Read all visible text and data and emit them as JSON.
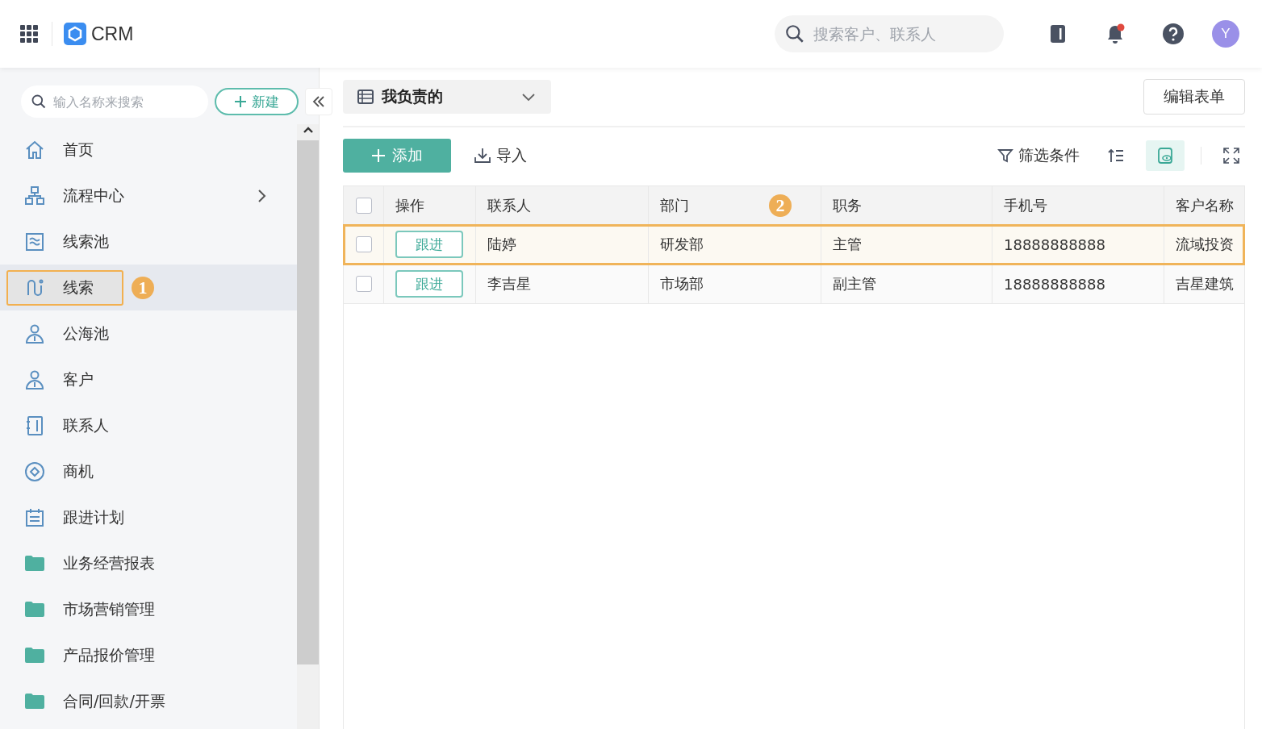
{
  "topbar": {
    "app_name": "CRM",
    "search": {
      "placeholder": "搜索客户、联系人"
    },
    "notification_dot": true,
    "avatar": "Y"
  },
  "sidebar": {
    "search": {
      "placeholder": "输入名称来搜索"
    },
    "new_button": "新建",
    "items": [
      {
        "label": "首页",
        "kind": "page",
        "selected": false,
        "expandable": false
      },
      {
        "label": "流程中心",
        "kind": "page",
        "selected": false,
        "expandable": true
      },
      {
        "label": "线索池",
        "kind": "page",
        "selected": false,
        "expandable": false
      },
      {
        "label": "线索",
        "kind": "page",
        "selected": true,
        "expandable": false,
        "callout": "1"
      },
      {
        "label": "公海池",
        "kind": "page",
        "selected": false,
        "expandable": false
      },
      {
        "label": "客户",
        "kind": "page",
        "selected": false,
        "expandable": false
      },
      {
        "label": "联系人",
        "kind": "page",
        "selected": false,
        "expandable": false
      },
      {
        "label": "商机",
        "kind": "page",
        "selected": false,
        "expandable": false
      },
      {
        "label": "跟进计划",
        "kind": "page",
        "selected": false,
        "expandable": false
      },
      {
        "label": "业务经营报表",
        "kind": "folder",
        "selected": false,
        "expandable": false
      },
      {
        "label": "市场营销管理",
        "kind": "folder",
        "selected": false,
        "expandable": false
      },
      {
        "label": "产品报价管理",
        "kind": "folder",
        "selected": false,
        "expandable": false
      },
      {
        "label": "合同/回款/开票",
        "kind": "folder",
        "selected": false,
        "expandable": false
      }
    ]
  },
  "view_selector": "我负责的",
  "edit_form_button": "编辑表单",
  "toolbar": {
    "add_button": "添加",
    "import_button": "导入",
    "filter_button": "筛选条件",
    "view_toggle_on": true
  },
  "table": {
    "all_checked": false,
    "columns": [
      {
        "label": "操作"
      },
      {
        "label": "联系人"
      },
      {
        "label": "部门",
        "callout": "2"
      },
      {
        "label": "职务"
      },
      {
        "label": "手机号"
      },
      {
        "label": "客户名称"
      }
    ],
    "rows": [
      {
        "checked": false,
        "highlighted": true,
        "cells": [
          "跟进",
          "陆婷",
          "研发部",
          "主管",
          "18888888888",
          "流域投资"
        ]
      },
      {
        "checked": false,
        "highlighted": false,
        "cells": [
          "跟进",
          "李吉星",
          "市场部",
          "副主管",
          "18888888888",
          "吉星建筑"
        ]
      }
    ]
  }
}
